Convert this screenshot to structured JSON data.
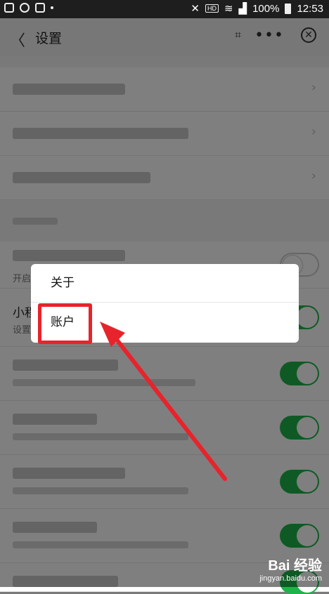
{
  "status_bar": {
    "battery": "100%",
    "time": "12:53",
    "hd": "HD"
  },
  "header": {
    "title": "设置"
  },
  "peek": {
    "row_partial": "小程",
    "row_partial_sub": "设置",
    "row_open": "开启"
  },
  "popup_menu": {
    "items": [
      {
        "label": "关于"
      },
      {
        "label": "账户"
      }
    ]
  },
  "watermark": {
    "brand": "Bai 经验",
    "url": "jingyan.baidu.com"
  }
}
